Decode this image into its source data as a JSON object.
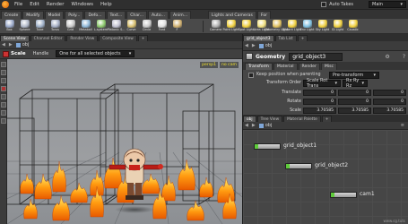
{
  "menubar": {
    "items": [
      "File",
      "Edit",
      "Render",
      "Windows",
      "Help"
    ],
    "auto_takes_label": "Auto Takes",
    "desktop": "Main"
  },
  "shelf": {
    "left_tabs": [
      "Create",
      "Modify",
      "Model",
      "Poly...",
      "Defo...",
      "Text...",
      "Char...",
      "Auto...",
      "Anim..."
    ],
    "right_tabs": [
      "Lights and Cameras",
      "For"
    ],
    "left_tools": [
      {
        "label": "Box",
        "icon": "box-icon",
        "color": "#9aa9c9"
      },
      {
        "label": "Sphere",
        "icon": "sphere-icon",
        "color": "#b0b8c8"
      },
      {
        "label": "Tube",
        "icon": "tube-icon",
        "color": "#9fb0c8"
      },
      {
        "label": "Torus",
        "icon": "torus-icon",
        "color": "#a5aec4"
      },
      {
        "label": "Grid",
        "icon": "grid-icon",
        "color": "#c8c8c8"
      },
      {
        "label": "Metaball",
        "icon": "metaball-icon",
        "color": "#8fb8d8"
      },
      {
        "label": "L-system",
        "icon": "lsystem-icon",
        "color": "#8cc86c"
      },
      {
        "label": "Platonic S...",
        "icon": "platonic-icon",
        "color": "#c0c0d0"
      },
      {
        "label": "Curve",
        "icon": "curve-icon",
        "color": "#d8c070"
      },
      {
        "label": "Circle",
        "icon": "circle-icon",
        "color": "#c9c9c9"
      },
      {
        "label": "Font",
        "icon": "font-icon",
        "color": "#e0e0e0"
      },
      {
        "label": "F",
        "icon": "file-icon",
        "color": "#d0b070"
      }
    ],
    "right_tools": [
      {
        "label": "Camera",
        "icon": "camera-icon",
        "color": "#b0b0b0"
      },
      {
        "label": "Point Light",
        "icon": "point-light-icon",
        "color": "#f0d040"
      },
      {
        "label": "Spot Light",
        "icon": "spot-light-icon",
        "color": "#f0d040"
      },
      {
        "label": "Area Light",
        "icon": "area-light-icon",
        "color": "#f0e080"
      },
      {
        "label": "Geometry Light",
        "icon": "geometry-light-icon",
        "color": "#e0c060"
      },
      {
        "label": "Distant Light",
        "icon": "distant-light-icon",
        "color": "#f0d040"
      },
      {
        "label": "Env Light",
        "icon": "env-light-icon",
        "color": "#80c0e0"
      },
      {
        "label": "Sky Light",
        "icon": "sky-light-icon",
        "color": "#f0d040"
      },
      {
        "label": "GI Light",
        "icon": "gi-light-icon",
        "color": "#f0d040"
      },
      {
        "label": "Caustic",
        "icon": "caustic-icon",
        "color": "#f0d040"
      }
    ]
  },
  "viewport_pane": {
    "tabs": [
      "Scene View",
      "Channel Editor",
      "Render View",
      "Composite View"
    ],
    "active_tab": 0,
    "path": "obj",
    "toolbar": {
      "title": "Scale",
      "handle_label": "Handle",
      "handle_value": "One for all selected objects"
    },
    "cam_label": "persp1",
    "cam_option": "no cam"
  },
  "parameters_pane": {
    "tabs": [
      "grid_object3",
      "Tab List"
    ],
    "active_tab": 0,
    "path": "obj",
    "node_type": "Geometry",
    "node_name": "grid_object3",
    "subtabs": [
      "Transform",
      "Material",
      "Render",
      "Misc"
    ],
    "active_subtab": 0,
    "keep_position_label": "Keep position when parenting",
    "keep_position_value": "Pre-transform",
    "transform_order_label": "Transform Order",
    "transform_order_value": "Scale Rot Trans",
    "rotate_order_value": "Rx Ry Rz",
    "rows": [
      {
        "label": "Translate",
        "values": [
          "0",
          "0",
          "0"
        ]
      },
      {
        "label": "Rotate",
        "values": [
          "0",
          "0",
          "0"
        ]
      },
      {
        "label": "Scale",
        "values": [
          "3.70585",
          "3.70585",
          "3.70585"
        ]
      }
    ]
  },
  "network_pane": {
    "tabs": [
      "obj",
      "Tree View",
      "Material Palette"
    ],
    "active_tab": 0,
    "path": "obj",
    "nodes": [
      {
        "name": "grid_object1",
        "flag_color": "#5ecb3a"
      },
      {
        "name": "grid_object2",
        "flag_color": "#5ecb3a"
      },
      {
        "name": "cam1",
        "flag_color": "#5ecb3a"
      }
    ]
  },
  "watermark": "www.cg.tuts"
}
